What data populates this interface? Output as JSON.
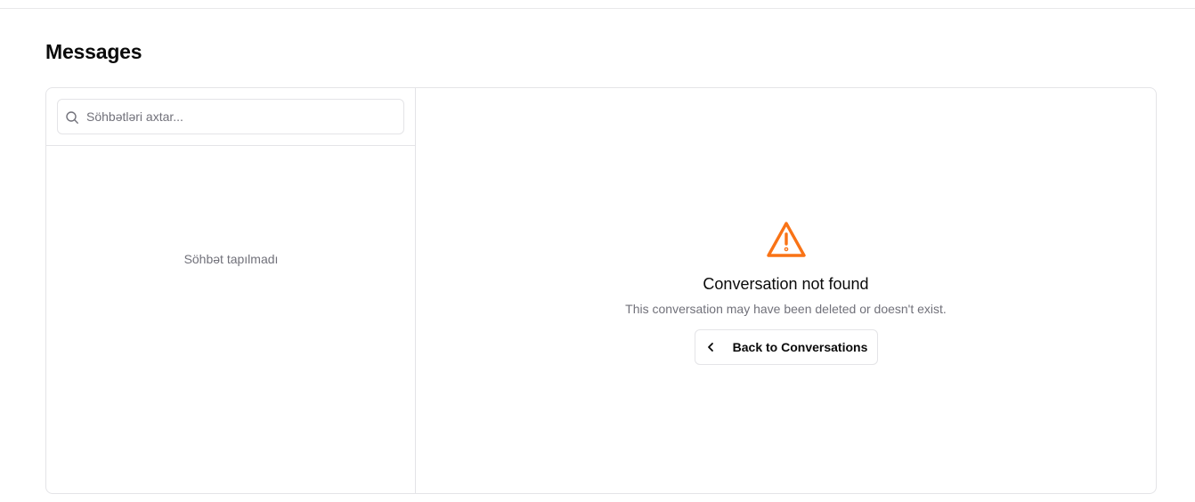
{
  "page": {
    "title": "Messages"
  },
  "sidebar": {
    "search": {
      "placeholder": "Söhbətləri axtar...",
      "value": "",
      "icon": "search-icon"
    },
    "empty_text": "Söhbət tapılmadı"
  },
  "main": {
    "state": {
      "icon": "warning-triangle-icon",
      "title": "Conversation not found",
      "subtitle": "This conversation may have been deleted or doesn't exist.",
      "back_button": {
        "label": "Back to Conversations",
        "icon": "chevron-left-icon"
      }
    }
  },
  "colors": {
    "warning": "#f97316",
    "border": "#e4e4e7",
    "muted_text": "#71717a",
    "text": "#0a0a0a",
    "background": "#ffffff"
  }
}
